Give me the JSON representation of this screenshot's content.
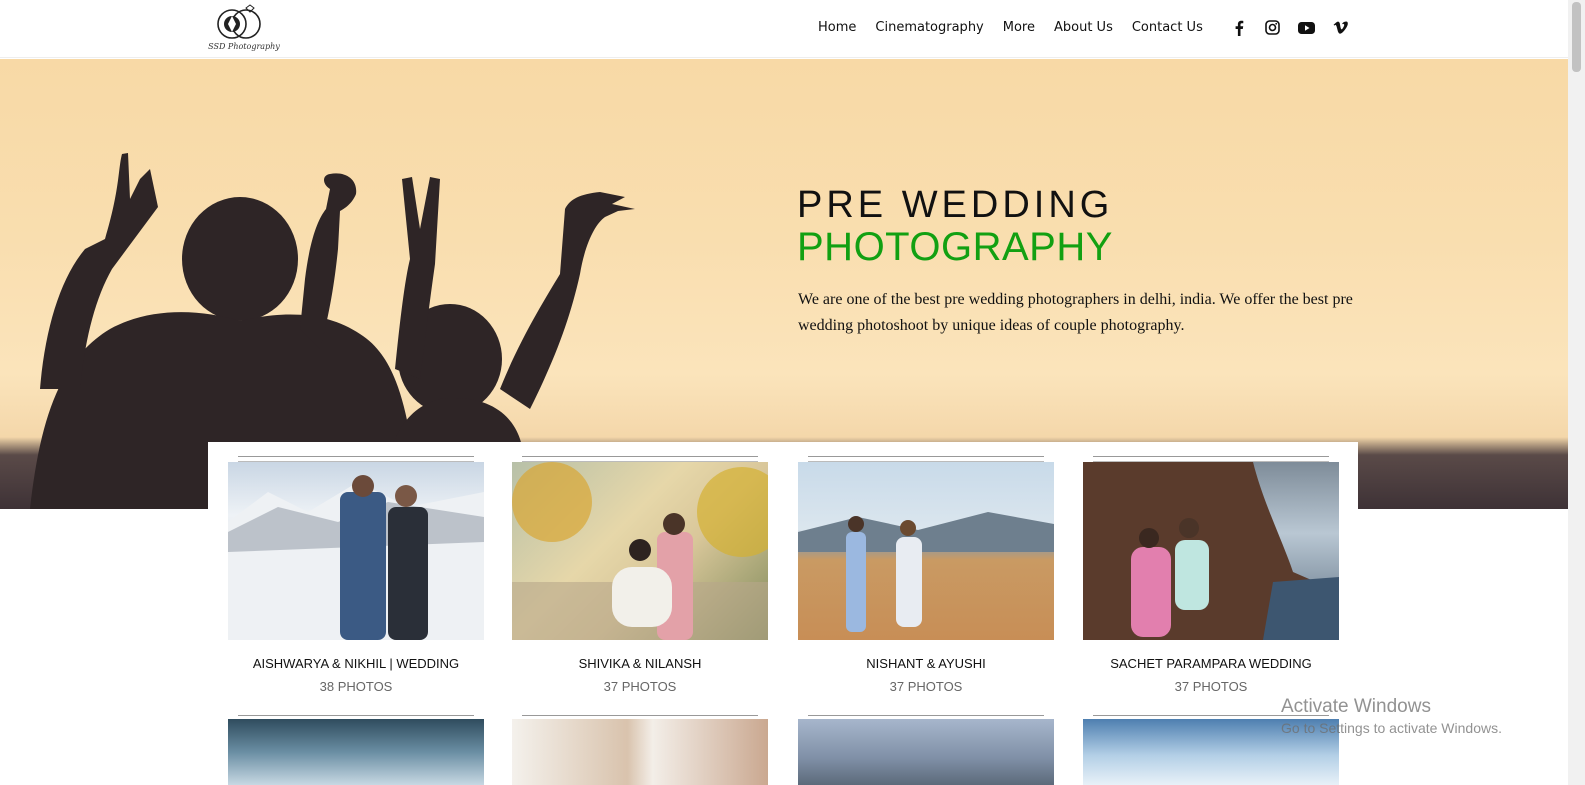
{
  "brand": {
    "caption": "SSD Photography"
  },
  "nav": [
    "Home",
    "Cinematography",
    "More",
    "About Us",
    "Contact Us"
  ],
  "social_icons": [
    "facebook-icon",
    "instagram-icon",
    "youtube-icon",
    "vimeo-icon"
  ],
  "hero": {
    "title_line1": "PRE WEDDING",
    "title_line2": "PHOTOGRAPHY",
    "description": "We are one of the best pre wedding photographers in delhi, india. We offer the best pre wedding photoshoot by unique ideas of couple photography."
  },
  "albums": [
    {
      "title": "AISHWARYA & NIKHIL | WEDDING",
      "count": "38 PHOTOS"
    },
    {
      "title": "SHIVIKA & NILANSH",
      "count": "37 PHOTOS"
    },
    {
      "title": "NISHANT & AYUSHI",
      "count": "37 PHOTOS"
    },
    {
      "title": "SACHET PARAMPARA WEDDING",
      "count": "37 PHOTOS"
    }
  ],
  "watermark": {
    "line1": "Activate Windows",
    "line2": "Go to Settings to activate Windows."
  },
  "colors": {
    "accent_green": "#12a012",
    "hero_sky": "#f9deaf"
  }
}
